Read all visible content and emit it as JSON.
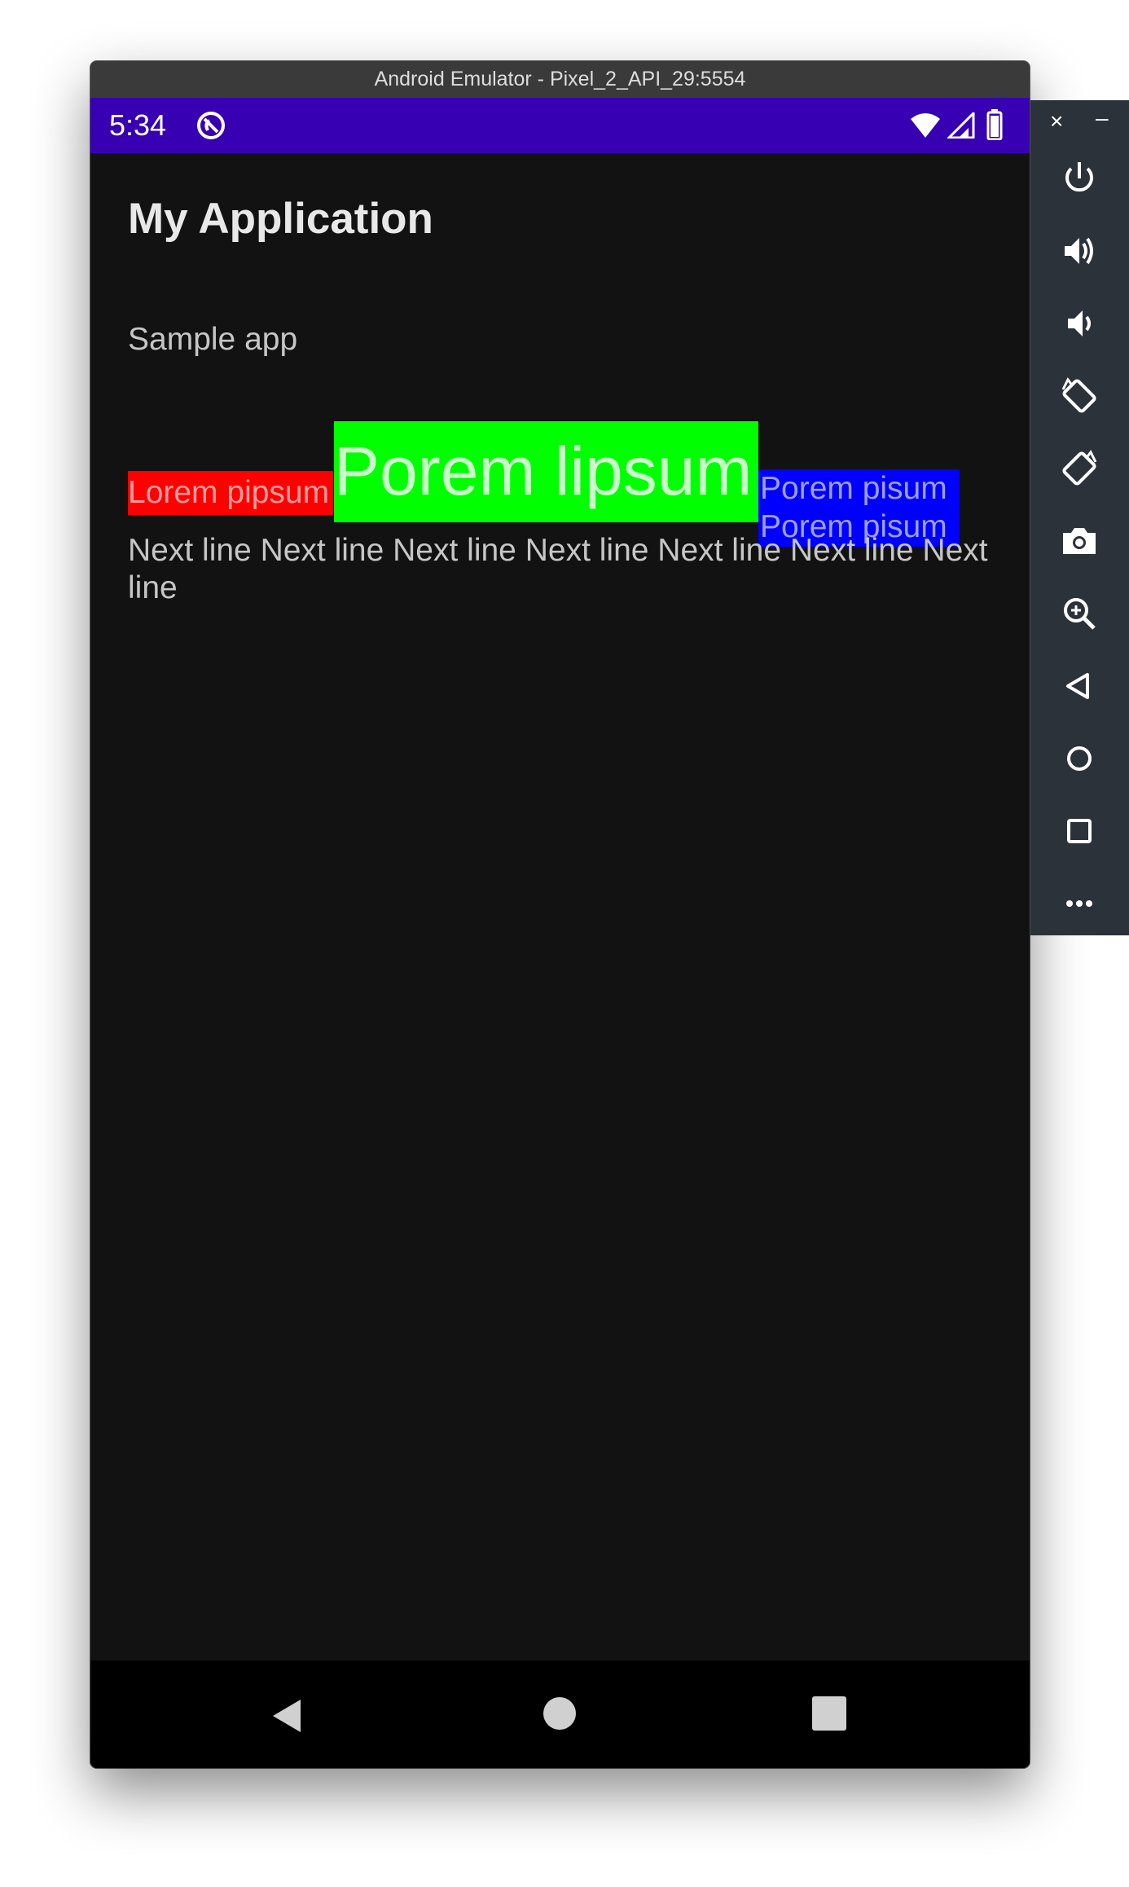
{
  "window": {
    "title": "Android Emulator - Pixel_2_API_29:5554"
  },
  "status_bar": {
    "time": "5:34",
    "icons": [
      "app-notification-icon",
      "wifi-icon",
      "signal-icon",
      "battery-icon"
    ],
    "background": "#3700b3"
  },
  "app": {
    "title": "My Application",
    "sample_text": "Sample app",
    "spans": {
      "red": {
        "text": "Lorem pipsum",
        "background": "#ff0000"
      },
      "green": {
        "text": "Porem lipsum",
        "background": "#00ff00"
      },
      "blue": {
        "text": "Porem pisum Porem pisum",
        "background": "#0000ff"
      }
    },
    "next_line": "Next line Next line Next line Next line Next line Next line Next line"
  },
  "nav_bar": {
    "buttons": [
      "back",
      "home",
      "recents"
    ]
  },
  "toolbar": {
    "close": "×",
    "minimize": "–",
    "items": [
      "power",
      "volume-up",
      "volume-down",
      "rotate-left",
      "rotate-right",
      "screenshot",
      "zoom",
      "back",
      "home",
      "overview",
      "more"
    ]
  }
}
